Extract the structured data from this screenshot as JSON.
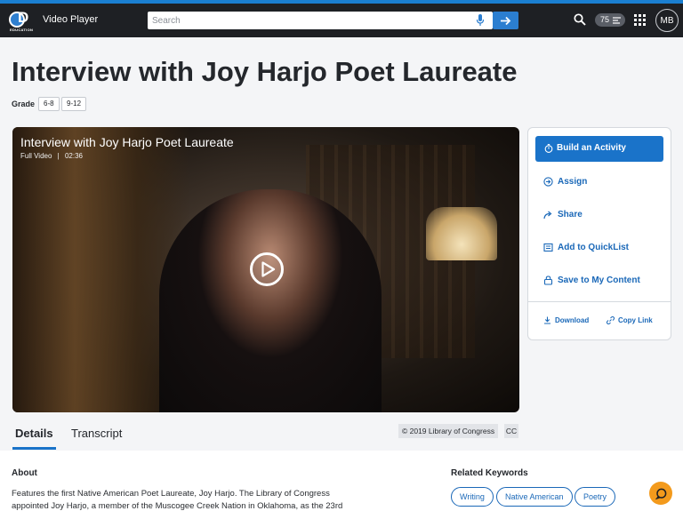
{
  "header": {
    "logo_text": "EDUCATION",
    "app_title": "Video Player",
    "search_placeholder": "Search",
    "notification_count": "75",
    "user_initials": "MB"
  },
  "page": {
    "title": "Interview with Joy Harjo Poet Laureate",
    "grade_label": "Grade",
    "grades": [
      "6-8",
      "9-12"
    ]
  },
  "video": {
    "title": "Interview with Joy Harjo Poet Laureate",
    "type": "Full Video",
    "separator": "|",
    "duration": "02:36"
  },
  "actions": {
    "build_activity": "Build an Activity",
    "assign": "Assign",
    "share": "Share",
    "add_quicklist": "Add to QuickList",
    "save_content": "Save to My Content",
    "download": "Download",
    "copy_link": "Copy Link"
  },
  "tabs": [
    {
      "label": "Details",
      "active": true
    },
    {
      "label": "Transcript",
      "active": false
    }
  ],
  "copyright": "© 2019 Library of Congress",
  "cc_label": "CC",
  "about": {
    "heading": "About",
    "text": "Features the first Native American Poet Laureate, Joy Harjo. The Library of Congress appointed Joy Harjo, a member of the Muscogee Creek Nation in Oklahoma, as the 23rd"
  },
  "keywords": {
    "heading": "Related Keywords",
    "items": [
      "Writing",
      "Native American",
      "Poetry"
    ]
  },
  "colors": {
    "accent": "#1a73c9",
    "topbar": "#1e2024",
    "chat": "#f39a1c"
  }
}
